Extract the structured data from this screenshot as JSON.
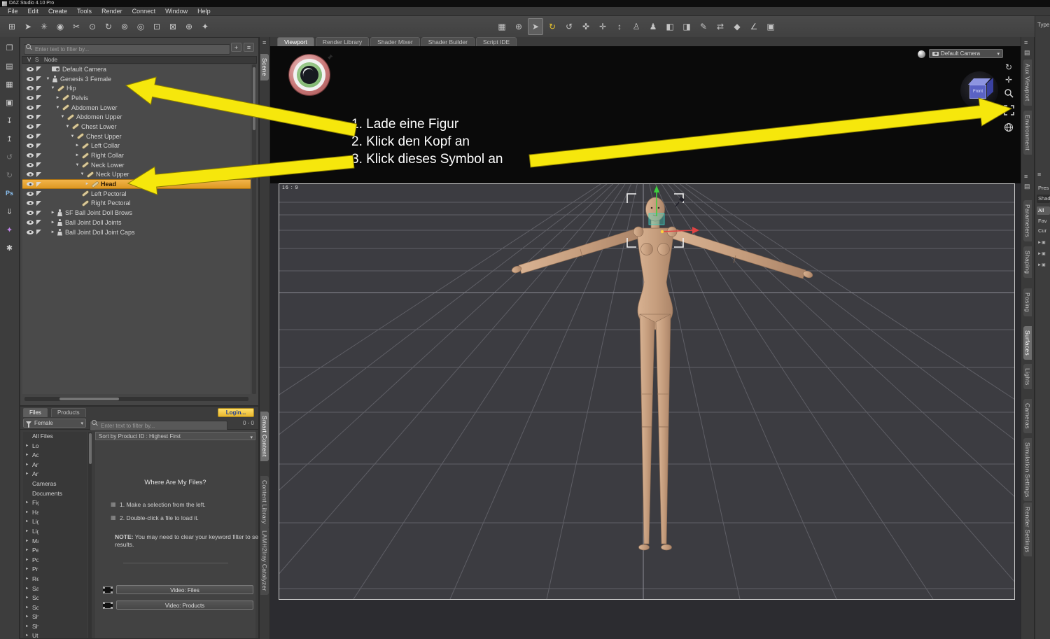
{
  "window": {
    "title": "DAZ Studio 4.10 Pro"
  },
  "menu": {
    "items": [
      "File",
      "Edit",
      "Create",
      "Tools",
      "Render",
      "Connect",
      "Window",
      "Help"
    ]
  },
  "left_rail": {
    "icons": [
      {
        "name": "new-file-icon",
        "glyph": "❐"
      },
      {
        "name": "render-queue-icon",
        "glyph": "▤"
      },
      {
        "name": "open-file-icon",
        "glyph": "▦"
      },
      {
        "name": "save-icon",
        "glyph": "▣"
      },
      {
        "name": "import-icon",
        "glyph": "↧"
      },
      {
        "name": "export-icon",
        "glyph": "↥"
      },
      {
        "name": "undo-icon",
        "glyph": "↺"
      },
      {
        "name": "redo-icon",
        "glyph": "↻"
      },
      {
        "name": "photoshop-bridge-icon",
        "glyph": "Ps"
      },
      {
        "name": "install-manager-icon",
        "glyph": "⇓"
      },
      {
        "name": "dforce-icon",
        "glyph": "✦"
      },
      {
        "name": "content-wizard-icon",
        "glyph": "✱"
      }
    ]
  },
  "toolbar": {
    "left_icons": [
      {
        "name": "node-create-icon",
        "glyph": "⊞"
      },
      {
        "name": "node-edit-icon",
        "glyph": "➤"
      },
      {
        "name": "node-align-icon",
        "glyph": "✳"
      },
      {
        "name": "sphere-gizmo-icon",
        "glyph": "◉"
      },
      {
        "name": "node-cut-icon",
        "glyph": "✂"
      },
      {
        "name": "pin-translation-icon",
        "glyph": "⊙"
      },
      {
        "name": "pin-rotation-icon",
        "glyph": "↻"
      },
      {
        "name": "unpin-icon",
        "glyph": "⊚"
      },
      {
        "name": "target-icon",
        "glyph": "◎"
      },
      {
        "name": "cube-node-icon",
        "glyph": "⊡"
      },
      {
        "name": "cube-pin-icon",
        "glyph": "⊠"
      },
      {
        "name": "cube-add-icon",
        "glyph": "⊕"
      },
      {
        "name": "cube-star-icon",
        "glyph": "✦"
      }
    ],
    "main_icons": [
      {
        "name": "spot-render-icon",
        "glyph": "▦"
      },
      {
        "name": "aim-at-icon",
        "glyph": "⊕"
      },
      {
        "name": "node-selection-tool-icon",
        "glyph": "➤",
        "active": true
      },
      {
        "name": "rotate-tool-icon",
        "glyph": "↻"
      },
      {
        "name": "active-pose-tool-icon",
        "glyph": "↺"
      },
      {
        "name": "universal-tool-icon",
        "glyph": "✜"
      },
      {
        "name": "translate-tool-icon",
        "glyph": "✛"
      },
      {
        "name": "scale-tool-icon",
        "glyph": "↕"
      },
      {
        "name": "figure-setup-icon",
        "glyph": "♙"
      },
      {
        "name": "joint-editor-icon",
        "glyph": "♟"
      },
      {
        "name": "surface-selection-icon",
        "glyph": "◧"
      },
      {
        "name": "geometry-editor-icon",
        "glyph": "◨"
      },
      {
        "name": "polygon-paint-icon",
        "glyph": "✎"
      },
      {
        "name": "transfer-utility-icon",
        "glyph": "⇄"
      },
      {
        "name": "keyframe-icon",
        "glyph": "◆"
      },
      {
        "name": "measure-icon",
        "glyph": "∠"
      },
      {
        "name": "render-camera-icon",
        "glyph": "▣"
      }
    ]
  },
  "scene_panel": {
    "filter_placeholder": "Enter text to filter by...",
    "add_button": "+",
    "menu_button": "≡",
    "columns": [
      "V",
      "S",
      "Node"
    ],
    "nodes": [
      {
        "label": "Default Camera",
        "depth": 0,
        "state": "leaf",
        "icon": "camera"
      },
      {
        "label": "Genesis 3 Female",
        "depth": 0,
        "state": "open",
        "icon": "figure"
      },
      {
        "label": "Hip",
        "depth": 1,
        "state": "open",
        "icon": "bone"
      },
      {
        "label": "Pelvis",
        "depth": 2,
        "state": "closed",
        "icon": "bone"
      },
      {
        "label": "Abdomen Lower",
        "depth": 2,
        "state": "open",
        "icon": "bone"
      },
      {
        "label": "Abdomen Upper",
        "depth": 3,
        "state": "open",
        "icon": "bone"
      },
      {
        "label": "Chest Lower",
        "depth": 4,
        "state": "open",
        "icon": "bone"
      },
      {
        "label": "Chest Upper",
        "depth": 5,
        "state": "open",
        "icon": "bone"
      },
      {
        "label": "Left Collar",
        "depth": 6,
        "state": "closed",
        "icon": "bone"
      },
      {
        "label": "Right Collar",
        "depth": 6,
        "state": "closed",
        "icon": "bone"
      },
      {
        "label": "Neck Lower",
        "depth": 6,
        "state": "open",
        "icon": "bone"
      },
      {
        "label": "Neck Upper",
        "depth": 7,
        "state": "open",
        "icon": "bone"
      },
      {
        "label": "Head",
        "depth": 8,
        "state": "closed",
        "icon": "bone",
        "selected": true
      },
      {
        "label": "Left Pectoral",
        "depth": 6,
        "state": "leaf",
        "icon": "bone"
      },
      {
        "label": "Right Pectoral",
        "depth": 6,
        "state": "leaf",
        "icon": "bone"
      },
      {
        "label": "SF Ball Joint Doll Brows",
        "depth": 1,
        "state": "closed",
        "icon": "figure"
      },
      {
        "label": "Ball Joint Doll Joints",
        "depth": 1,
        "state": "closed",
        "icon": "figure"
      },
      {
        "label": "Ball Joint Doll Joint Caps",
        "depth": 1,
        "state": "closed",
        "icon": "figure"
      }
    ]
  },
  "left_tabs": {
    "top": [
      "Scene"
    ],
    "bottom": [
      "Smart Content",
      "Content Library",
      "LAMH2Iray Catalyzer"
    ]
  },
  "smart_content": {
    "tabs": [
      "Files",
      "Products"
    ],
    "active_tab": "Files",
    "login_label": "Login...",
    "category_filter": "Female",
    "search_placeholder": "Enter text to filter by...",
    "result_count": "0 - 0",
    "sort_label": "Sort by Product ID : Highest First",
    "categories": [
      {
        "label": "All Files",
        "expandable": false
      },
      {
        "label": "Lost and Found",
        "expandable": true
      },
      {
        "label": "Accessories",
        "expandable": true
      },
      {
        "label": "Anatomy",
        "expandable": true
      },
      {
        "label": "Animations",
        "expandable": true
      },
      {
        "label": "Cameras",
        "expandable": false
      },
      {
        "label": "Documents",
        "expandable": false
      },
      {
        "label": "Figures",
        "expandable": true
      },
      {
        "label": "Hair",
        "expandable": true
      },
      {
        "label": "Light Sets",
        "expandable": true
      },
      {
        "label": "Lights",
        "expandable": true
      },
      {
        "label": "Materials",
        "expandable": true
      },
      {
        "label": "People",
        "expandable": true
      },
      {
        "label": "Poses",
        "expandable": true
      },
      {
        "label": "Props",
        "expandable": true
      },
      {
        "label": "Render-Settings",
        "expandable": true
      },
      {
        "label": "Saved Files",
        "expandable": true
      },
      {
        "label": "Scene Builder",
        "expandable": true
      },
      {
        "label": "Scripts",
        "expandable": true
      },
      {
        "label": "Shaders",
        "expandable": true
      },
      {
        "label": "Shaping",
        "expandable": true
      },
      {
        "label": "Utilities",
        "expandable": true
      }
    ],
    "help": {
      "title": "Where Are My Files?",
      "step1": "1. Make a selection from the left.",
      "step2": "2. Double-click a file to load it.",
      "note_label": "NOTE:",
      "note_text": "You may need to clear your keyword filter to see results."
    },
    "video_files_label": "Video: Files",
    "video_products_label": "Video:  Products"
  },
  "viewport": {
    "tabs": [
      "Viewport",
      "Render Library",
      "Shader Mixer",
      "Shader Builder",
      "Script IDE"
    ],
    "active_tab": "Viewport",
    "aspect_label": "16 : 9",
    "camera_selector": "Default Camera",
    "nav_cube_label": "Front",
    "control_icons": [
      "orbit-camera",
      "pan-camera",
      "zoom-camera",
      "frame-camera",
      "home-camera"
    ]
  },
  "right_tabs": {
    "items": [
      "Aux Viewport",
      "Environment",
      "Parameters",
      "Shaping",
      "Posing",
      "Surfaces",
      "Lights",
      "Cameras",
      "Simulation Settings",
      "Render Settings"
    ],
    "active": "Surfaces"
  },
  "right_edge": {
    "type_label": "Type :",
    "fragments": [
      "Pres",
      "Shade",
      "All",
      "Fav",
      "Cur"
    ]
  },
  "annotations": {
    "steps": [
      "1. Lade eine Figur",
      "2. Klick den Kopf an",
      "3. Klick dieses Symbol an"
    ],
    "arrow_color": "#f6e70c"
  },
  "colors": {
    "selection_orange": "#e8a035",
    "arrow_yellow": "#f6e70c",
    "login_yellow": "#f0cf3e"
  }
}
